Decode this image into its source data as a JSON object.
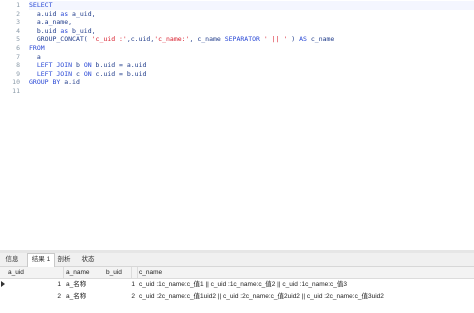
{
  "editor": {
    "line_numbers": [
      "1",
      "2",
      "3",
      "4",
      "5",
      "6",
      "7",
      "8",
      "9",
      "10",
      "11"
    ],
    "lines": [
      [
        {
          "t": "SELECT",
          "c": "kw"
        }
      ],
      [
        {
          "t": "  a.uid ",
          "c": "txt"
        },
        {
          "t": "as",
          "c": "kw"
        },
        {
          "t": " a_uid,",
          "c": "txt"
        }
      ],
      [
        {
          "t": "  a.a_name,",
          "c": "txt"
        }
      ],
      [
        {
          "t": "  b.uid ",
          "c": "txt"
        },
        {
          "t": "as",
          "c": "kw"
        },
        {
          "t": " b_uid,",
          "c": "txt"
        }
      ],
      [
        {
          "t": "  GROUP_CONCAT( ",
          "c": "fn"
        },
        {
          "t": "'c_uid :'",
          "c": "str"
        },
        {
          "t": ",c.uid,",
          "c": "txt"
        },
        {
          "t": "'c_name:'",
          "c": "str"
        },
        {
          "t": ", c_name ",
          "c": "txt"
        },
        {
          "t": "SEPARATOR",
          "c": "kw"
        },
        {
          "t": " ",
          "c": "txt"
        },
        {
          "t": "' || '",
          "c": "str"
        },
        {
          "t": " ) ",
          "c": "txt"
        },
        {
          "t": "AS",
          "c": "kw"
        },
        {
          "t": " c_name",
          "c": "txt"
        }
      ],
      [
        {
          "t": "FROM",
          "c": "kw"
        }
      ],
      [
        {
          "t": "  a",
          "c": "txt"
        }
      ],
      [
        {
          "t": "  ",
          "c": "txt"
        },
        {
          "t": "LEFT JOIN",
          "c": "kw"
        },
        {
          "t": " b ",
          "c": "txt"
        },
        {
          "t": "ON",
          "c": "kw"
        },
        {
          "t": " b.uid = a.uid",
          "c": "txt"
        }
      ],
      [
        {
          "t": "  ",
          "c": "txt"
        },
        {
          "t": "LEFT JOIN",
          "c": "kw"
        },
        {
          "t": " c ",
          "c": "txt"
        },
        {
          "t": "ON",
          "c": "kw"
        },
        {
          "t": " c.uid = b.uid",
          "c": "txt"
        }
      ],
      [
        {
          "t": "GROUP BY",
          "c": "kw"
        },
        {
          "t": " a.id",
          "c": "txt"
        }
      ],
      [
        {
          "t": "",
          "c": "txt"
        }
      ]
    ]
  },
  "tabs": [
    "信息",
    "结果 1",
    "剖析",
    "状态"
  ],
  "active_tab": "结果 1",
  "grid": {
    "columns": [
      "a_uid",
      "a_name",
      "b_uid",
      "c_name"
    ],
    "rows": [
      {
        "a_uid": "1",
        "a_name": "a_名称",
        "b_uid": "1",
        "c_name": "c_uid :1c_name:c_值1 || c_uid :1c_name:c_值2 || c_uid :1c_name:c_值3",
        "current": true
      },
      {
        "a_uid": "2",
        "a_name": "a_名称",
        "b_uid": "2",
        "c_name": "c_uid :2c_name:c_值1uid2 || c_uid :2c_name:c_值2uid2 || c_uid :2c_name:c_值3uid2",
        "current": false
      }
    ]
  }
}
